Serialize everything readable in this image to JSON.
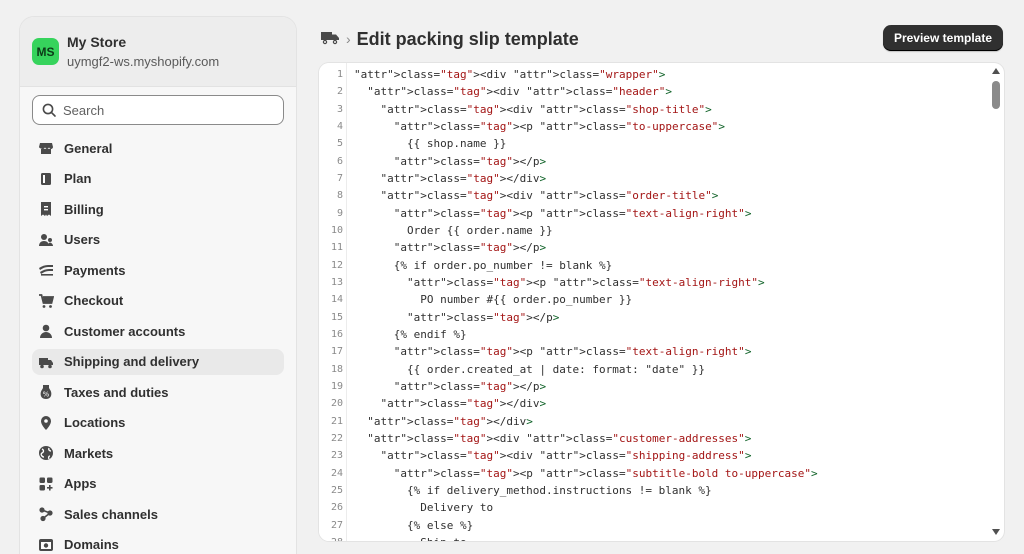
{
  "store": {
    "initials": "MS",
    "name": "My Store",
    "url": "uymgf2-ws.myshopify.com"
  },
  "search": {
    "placeholder": "Search"
  },
  "nav": [
    {
      "label": "General",
      "icon": "store-icon",
      "active": false
    },
    {
      "label": "Plan",
      "icon": "plan-icon",
      "active": false
    },
    {
      "label": "Billing",
      "icon": "billing-icon",
      "active": false
    },
    {
      "label": "Users",
      "icon": "users-icon",
      "active": false
    },
    {
      "label": "Payments",
      "icon": "payments-icon",
      "active": false
    },
    {
      "label": "Checkout",
      "icon": "cart-icon",
      "active": false
    },
    {
      "label": "Customer accounts",
      "icon": "person-icon",
      "active": false
    },
    {
      "label": "Shipping and delivery",
      "icon": "truck-icon",
      "active": true
    },
    {
      "label": "Taxes and duties",
      "icon": "tax-icon",
      "active": false
    },
    {
      "label": "Locations",
      "icon": "location-icon",
      "active": false
    },
    {
      "label": "Markets",
      "icon": "globe-icon",
      "active": false
    },
    {
      "label": "Apps",
      "icon": "apps-icon",
      "active": false
    },
    {
      "label": "Sales channels",
      "icon": "channels-icon",
      "active": false
    },
    {
      "label": "Domains",
      "icon": "domains-icon",
      "active": false
    }
  ],
  "header": {
    "title": "Edit packing slip template",
    "separator": "›",
    "preview_label": "Preview template"
  },
  "code_lines": [
    "<div class=\"wrapper\">",
    "  <div class=\"header\">",
    "    <div class=\"shop-title\">",
    "      <p class=\"to-uppercase\">",
    "        {{ shop.name }}",
    "      </p>",
    "    </div>",
    "    <div class=\"order-title\">",
    "      <p class=\"text-align-right\">",
    "        Order {{ order.name }}",
    "      </p>",
    "      {% if order.po_number != blank %}",
    "        <p class=\"text-align-right\">",
    "          PO number #{{ order.po_number }}",
    "        </p>",
    "      {% endif %}",
    "      <p class=\"text-align-right\">",
    "        {{ order.created_at | date: format: \"date\" }}",
    "      </p>",
    "    </div>",
    "  </div>",
    "  <div class=\"customer-addresses\">",
    "    <div class=\"shipping-address\">",
    "      <p class=\"subtitle-bold to-uppercase\">",
    "        {% if delivery_method.instructions != blank %}",
    "          Delivery to",
    "        {% else %}",
    "          Ship to"
  ]
}
